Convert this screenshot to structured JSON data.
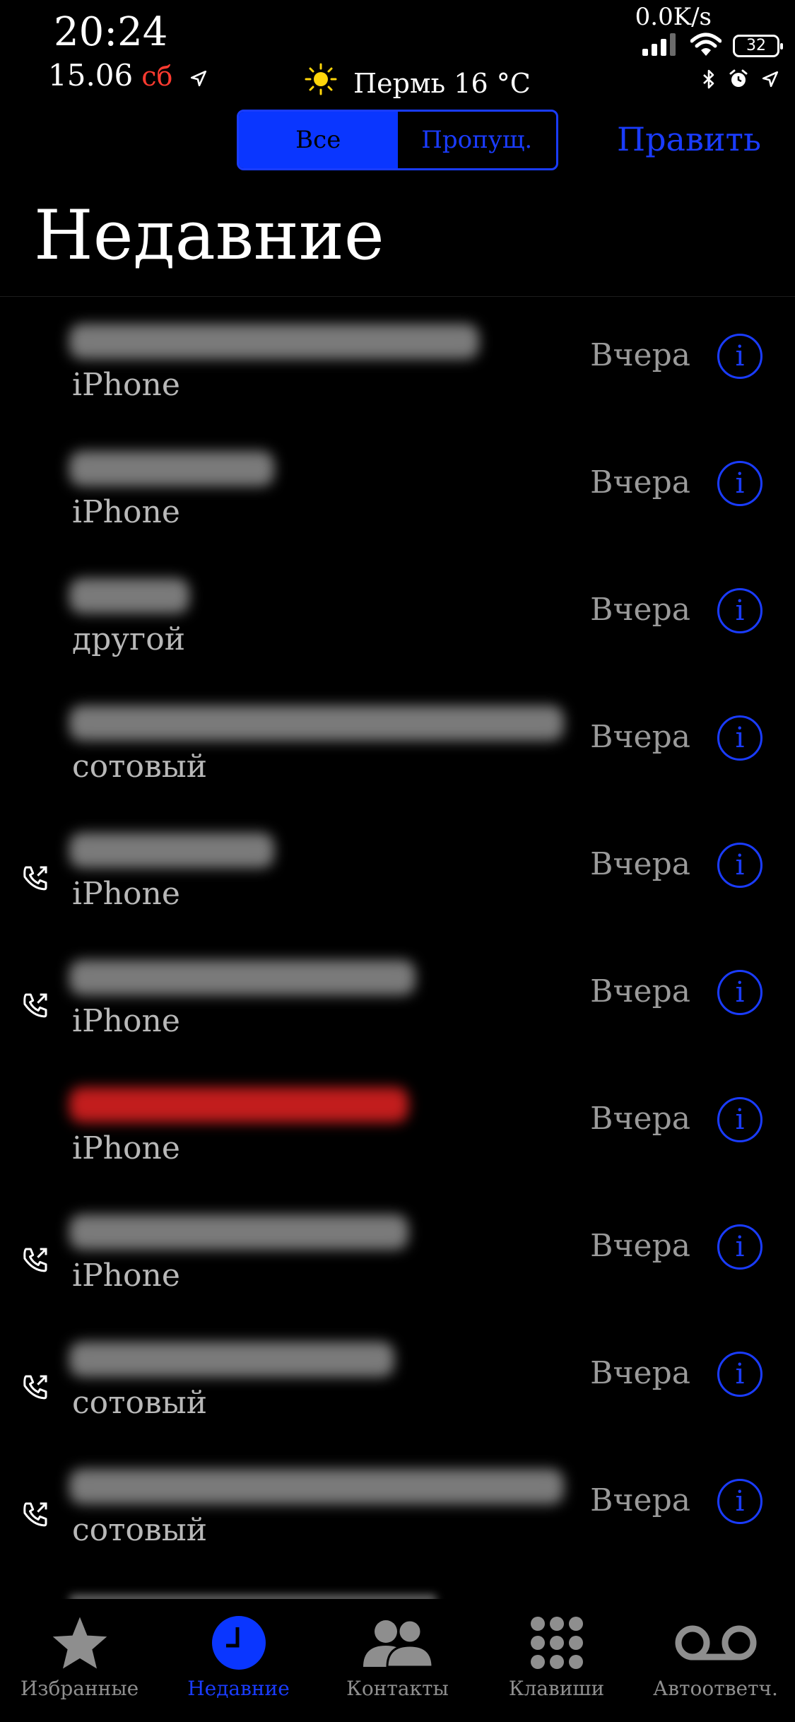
{
  "status_bar": {
    "time": "20:24",
    "date": "15.06",
    "day": "сб",
    "weather_text": "Пермь 16 °C",
    "net_speed": "0.0K/s",
    "battery": "32"
  },
  "header": {
    "segments": [
      {
        "label": "Все",
        "active": true
      },
      {
        "label": "Пропущ.",
        "active": false
      }
    ],
    "edit_label": "Править",
    "title": "Недавние"
  },
  "calls": [
    {
      "name": "",
      "type": "iPhone",
      "when": "Вчера",
      "outgoing": false,
      "missed": false
    },
    {
      "name": "",
      "type": "iPhone",
      "when": "Вчера",
      "outgoing": false,
      "missed": false
    },
    {
      "name": "",
      "type": "другой",
      "when": "Вчера",
      "outgoing": false,
      "missed": false
    },
    {
      "name": "",
      "type": "сотовый",
      "when": "Вчера",
      "outgoing": false,
      "missed": false
    },
    {
      "name": "",
      "type": "iPhone",
      "when": "Вчера",
      "outgoing": true,
      "missed": false
    },
    {
      "name": "",
      "type": "iPhone",
      "when": "Вчера",
      "outgoing": true,
      "missed": false
    },
    {
      "name": "",
      "type": "iPhone",
      "when": "Вчера",
      "outgoing": false,
      "missed": true
    },
    {
      "name": "",
      "type": "iPhone",
      "when": "Вчера",
      "outgoing": true,
      "missed": false
    },
    {
      "name": "",
      "type": "сотовый",
      "when": "Вчера",
      "outgoing": true,
      "missed": false
    },
    {
      "name": "",
      "type": "сотовый",
      "when": "Вчера",
      "outgoing": true,
      "missed": false
    }
  ],
  "tabs": [
    {
      "label": "Избранные",
      "icon": "star-icon",
      "selected": false
    },
    {
      "label": "Недавние",
      "icon": "clock-icon",
      "selected": true
    },
    {
      "label": "Контакты",
      "icon": "contacts-icon",
      "selected": false
    },
    {
      "label": "Клавиши",
      "icon": "keypad-icon",
      "selected": false
    },
    {
      "label": "Автоответч.",
      "icon": "voicemail-icon",
      "selected": false
    }
  ],
  "colors": {
    "accent": "#1a3cff",
    "missed": "#c21d1d",
    "secondary_text": "#9a9a9a"
  }
}
